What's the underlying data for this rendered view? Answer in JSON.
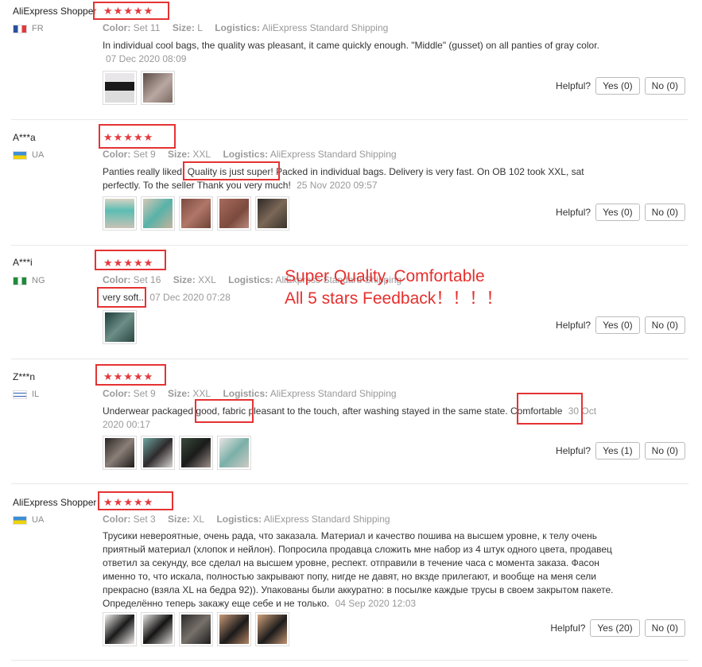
{
  "labels": {
    "color": "Color:",
    "size": "Size:",
    "logistics": "Logistics:",
    "helpful": "Helpful?"
  },
  "colors": {
    "accent_red": "#e53333",
    "star": "#e4393c"
  },
  "callout": {
    "line1": "Super Quality, Comfortable",
    "line2": "All 5 stars Feedback！！！！"
  },
  "reviews": [
    {
      "name": "AliExpress Shopper",
      "country": "FR",
      "stars": 5,
      "color": "Set 11",
      "size": "L",
      "logistics": "AliExpress Standard Shipping",
      "text": "In individual cool bags, the quality was pleasant, it came quickly enough. \"Middle\" (gusset) on all panties of gray color.",
      "date": "07 Dec 2020 08:09",
      "yes": "Yes (0)",
      "no": "No (0)"
    },
    {
      "name": "A***a",
      "country": "UA",
      "stars": 5,
      "color": "Set 9",
      "size": "XXL",
      "logistics": "AliExpress Standard Shipping",
      "text_a": "Panties really liked. ",
      "text_b": "Quality is just super!",
      "text_c": " Packed in individual bags. Delivery is very fast. On OB 102 took XXL, sat perfectly. To the seller Thank you very much!",
      "date": "25 Nov 2020 09:57",
      "yes": "Yes (0)",
      "no": "No (0)"
    },
    {
      "name": "A***i",
      "country": "NG",
      "stars": 5,
      "color": "Set 16",
      "size": "XXL",
      "logistics": "AliExpress Standard Shipping",
      "text": "very soft..",
      "date": "07 Dec 2020 07:28",
      "yes": "Yes (0)",
      "no": "No (0)"
    },
    {
      "name": "Z***n",
      "country": "IL",
      "stars": 5,
      "color": "Set 9",
      "size": "XXL",
      "logistics": "AliExpress Standard Shipping",
      "text_a": "Underwear packaged ",
      "text_b": "good, fabric",
      "text_c": " pleasant to the touch, after washing stayed in the same state. ",
      "text_d": "Comfortable",
      "date": "30 Oct 2020 00:17",
      "yes": "Yes (1)",
      "no": "No (0)"
    },
    {
      "name": "AliExpress Shopper",
      "country": "UA",
      "stars": 5,
      "color": "Set 3",
      "size": "XL",
      "logistics": "AliExpress Standard Shipping",
      "text": "Трусики невероятные, очень рада, что заказала. Материал и качество пошива на высшем уровне, к телу очень приятный материал (хлопок и нейлон). Попросила продавца сложить мне набор из 4 штук одного цвета, продавец ответил за секунду, все сделал на высшем уровне, респект. отправили в течение часа с момента заказа. Фасон именно то, что искала, полностью закрывают попу, нигде не давят, но вкзде прилегают, и вообще на меня сели прекрасно (взяла XL на бедра 92)). Упакованы были аккуратно: в посылке каждые трусы в своем закрытом пакете. Определённо теперь закажу еще себе и не только.",
      "date": "04 Sep 2020 12:03",
      "yes": "Yes (20)",
      "no": "No (0)"
    }
  ]
}
